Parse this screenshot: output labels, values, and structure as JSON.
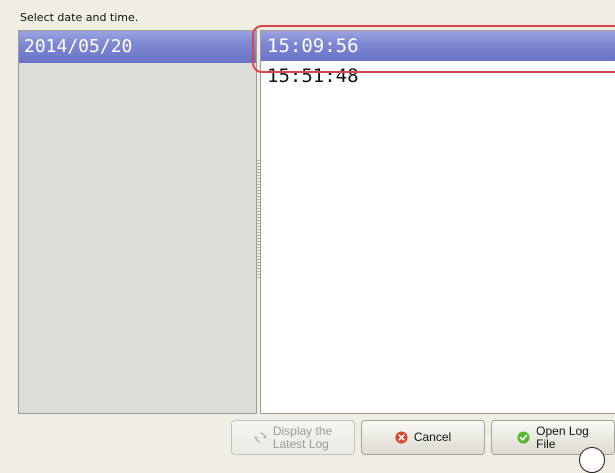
{
  "dialog": {
    "prompt": "Select date and time."
  },
  "dates": [
    {
      "label": "2014/05/20",
      "selected": true
    }
  ],
  "times": [
    {
      "label": "15:09:56",
      "selected": true
    },
    {
      "label": "15:51:48",
      "selected": false
    }
  ],
  "buttons": {
    "latest_log": {
      "line1": "Display the",
      "line2": "Latest Log",
      "enabled": false,
      "icon": "refresh-icon"
    },
    "cancel": {
      "label": "Cancel",
      "icon": "cancel-icon"
    },
    "open_log": {
      "line1": "Open Log",
      "line2": "File",
      "icon": "check-icon"
    }
  },
  "colors": {
    "selection": "#7c86d2",
    "focus_ring": "#d84848",
    "cancel_icon": "#d9462f",
    "open_icon": "#58b82e"
  }
}
